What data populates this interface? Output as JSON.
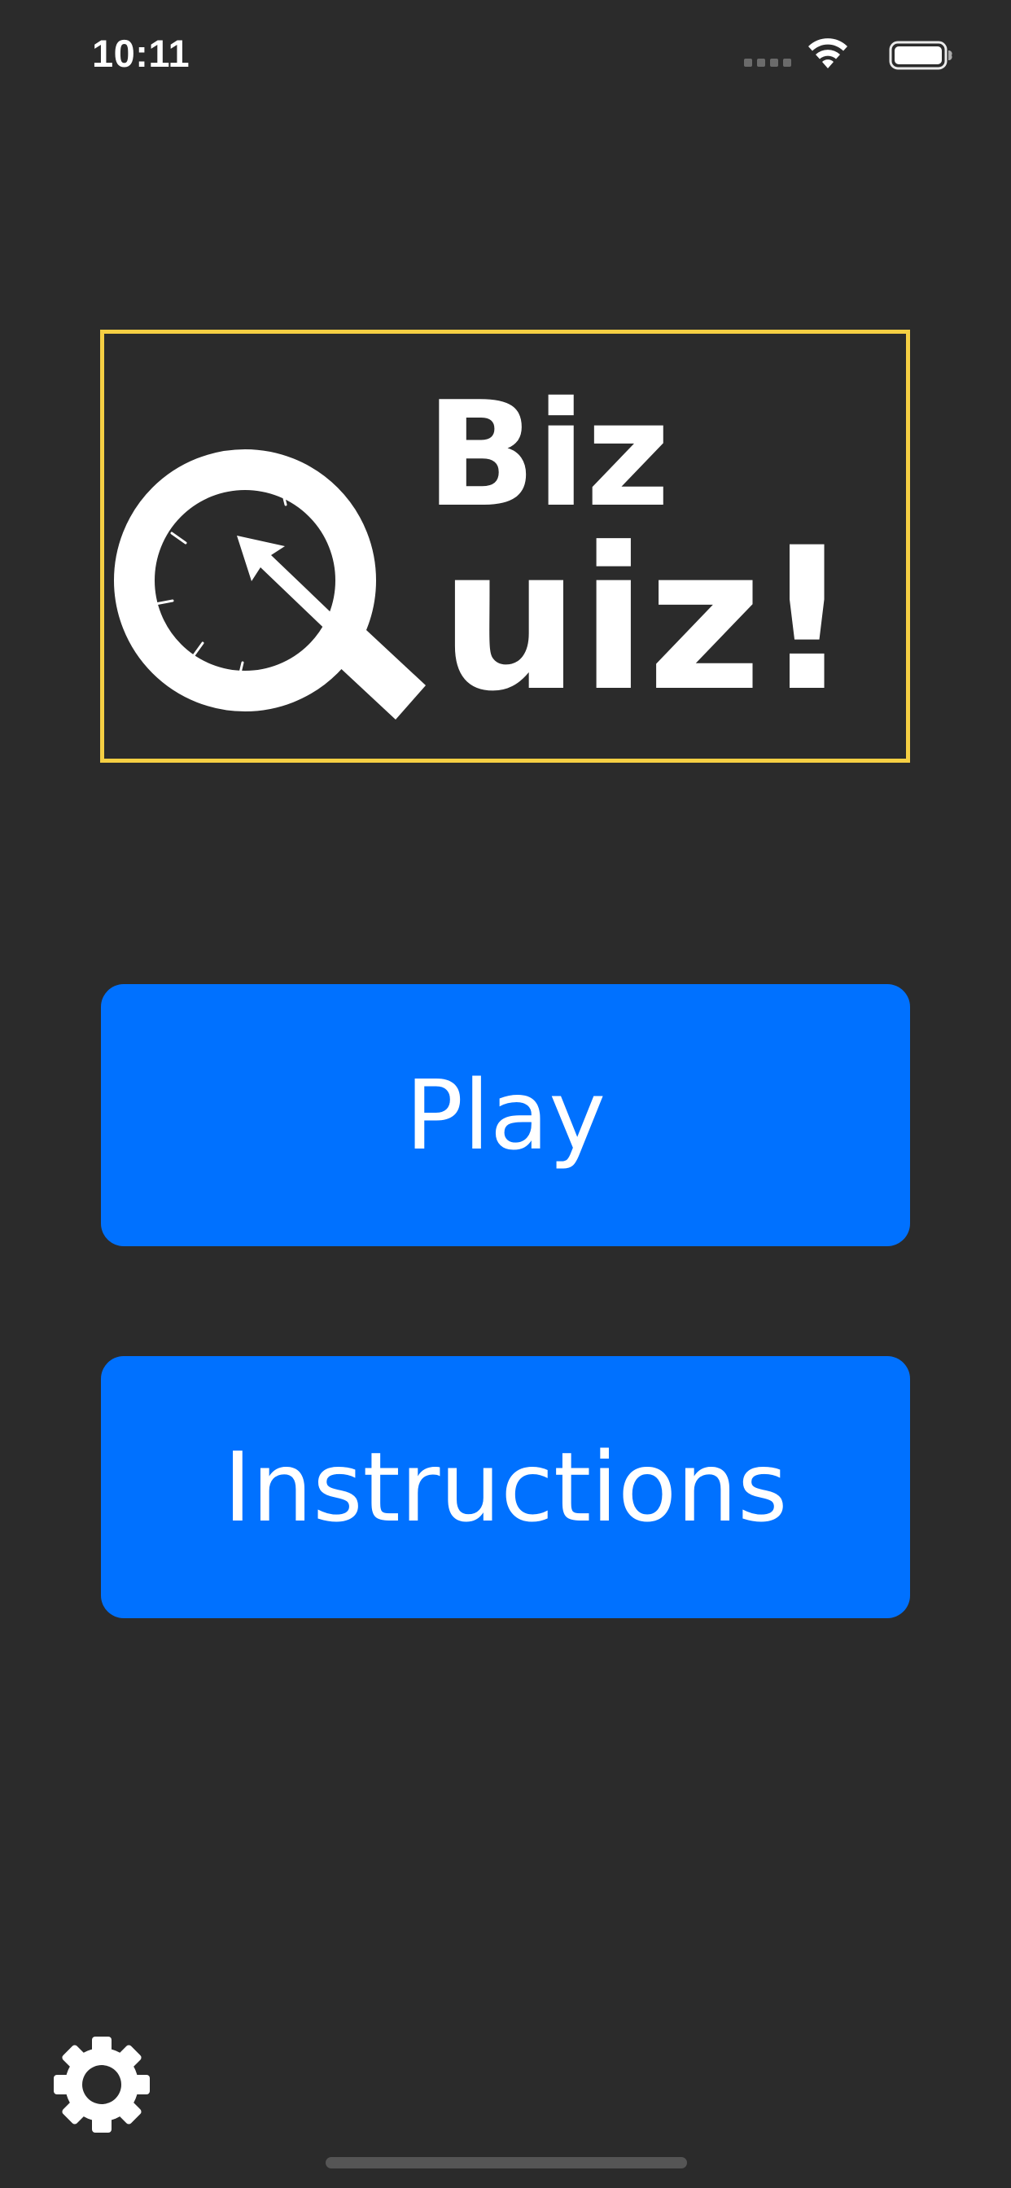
{
  "status_bar": {
    "time": "10:11",
    "icons": [
      "cellular-signal-icon",
      "wifi-icon",
      "battery-icon"
    ]
  },
  "logo": {
    "line1": "Biz",
    "line2": "uiz!",
    "icon": "stopwatch-q-icon",
    "frame_color": "#f5cf43"
  },
  "buttons": {
    "play_label": "Play",
    "instructions_label": "Instructions",
    "settings_icon": "gear-icon",
    "color": "#0071ff"
  },
  "theme": {
    "background": "#2b2b2b",
    "text": "#ffffff"
  }
}
